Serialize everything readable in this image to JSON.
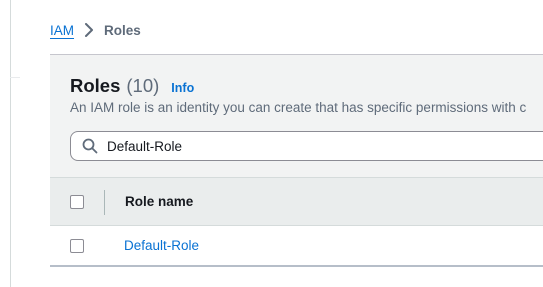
{
  "breadcrumb": {
    "root": "IAM",
    "separator_icon": "chevron-right-icon",
    "current": "Roles"
  },
  "roles_panel": {
    "title": "Roles",
    "count": "(10)",
    "info_link": "Info",
    "description": "An IAM role is an identity you can create that has specific permissions with c"
  },
  "search": {
    "icon": "search-icon",
    "value": "Default-Role"
  },
  "table": {
    "columns": [
      "Role name"
    ],
    "rows": [
      {
        "role_name": "Default-Role",
        "selected": false
      }
    ]
  },
  "colors": {
    "link": "#0972d3",
    "header_bg": "#f2f3f3",
    "table_head_bg": "#eaeded",
    "muted_text": "#5f6b7a"
  }
}
